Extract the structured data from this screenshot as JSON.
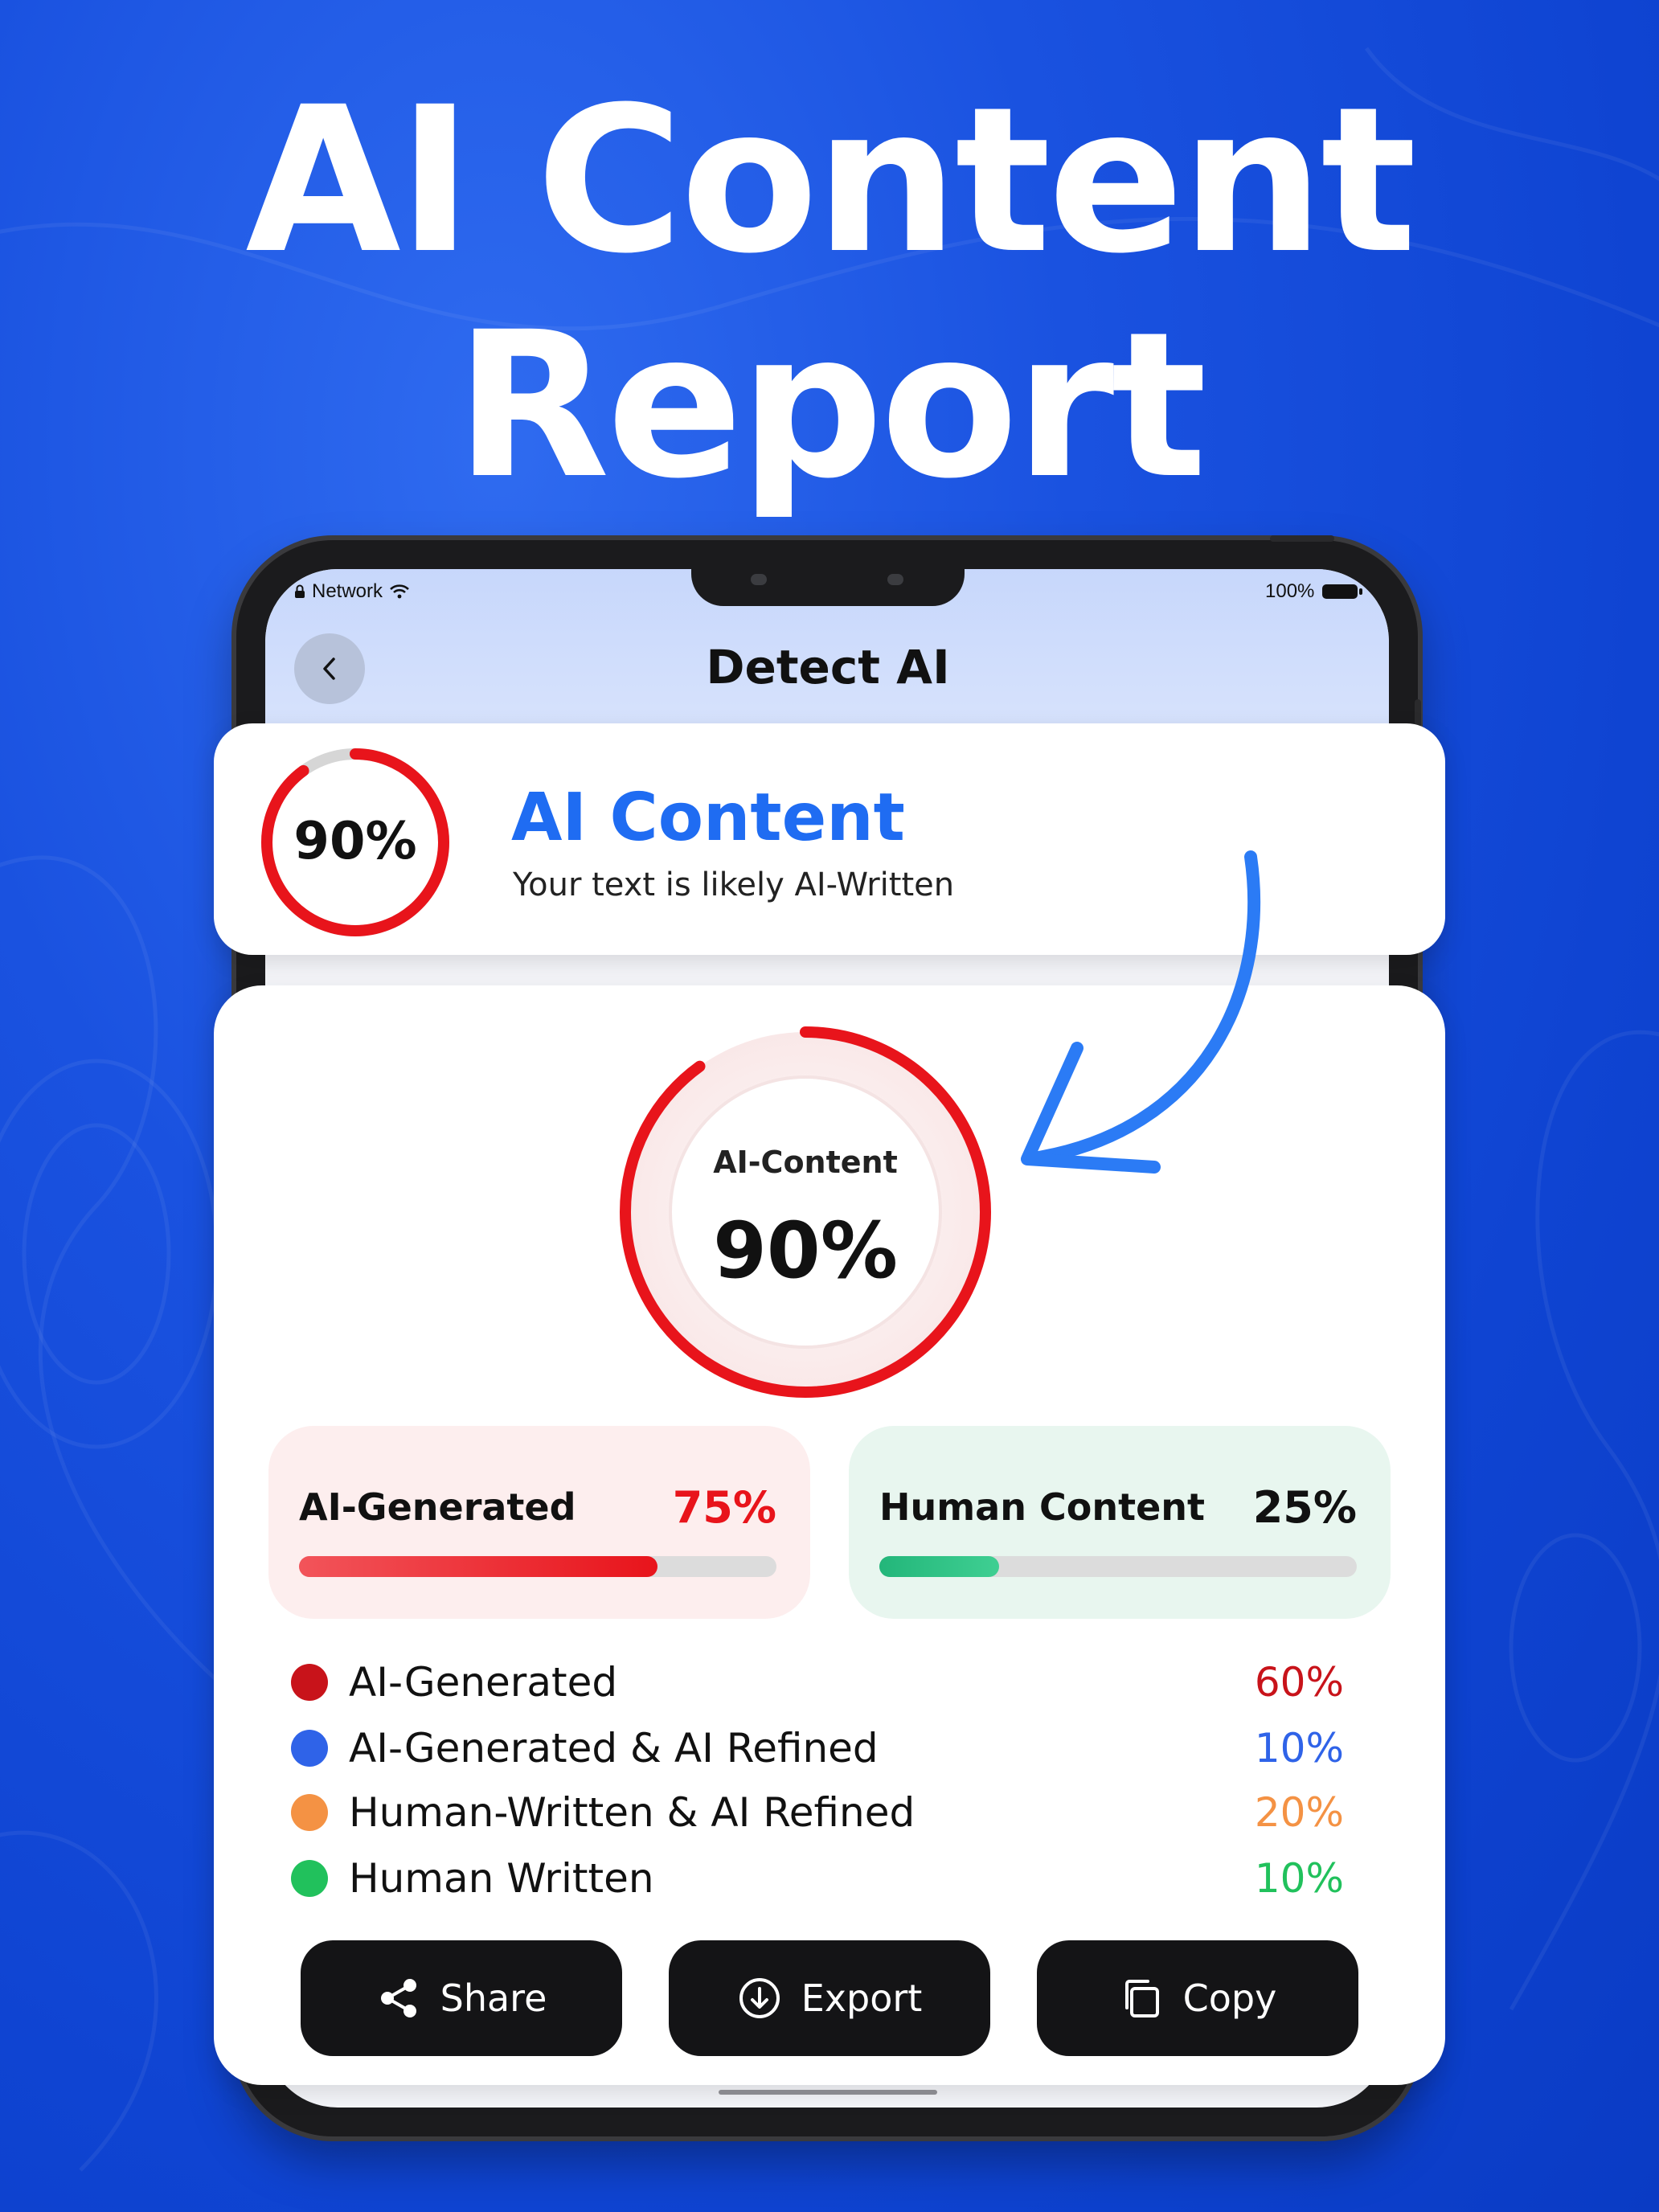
{
  "headline": {
    "line1": "AI Content",
    "line2": "Report"
  },
  "status_bar": {
    "network": "Network",
    "battery": "100%"
  },
  "nav": {
    "title": "Detect AI"
  },
  "summary_card": {
    "percent_label": "90%",
    "percent_value": 0.9,
    "title": "AI Content",
    "subtitle": "Your text is likely AI-Written"
  },
  "gauge": {
    "label": "AI-Content",
    "value_label": "90%",
    "value": 0.9
  },
  "stats": {
    "ai": {
      "label": "AI-Generated",
      "value_label": "75%",
      "value": 0.75
    },
    "human": {
      "label": "Human Content",
      "value_label": "25%",
      "value": 0.25
    }
  },
  "breakdown": [
    {
      "name": "AI-Generated",
      "value": "60%",
      "color": "#c8131a"
    },
    {
      "name": "AI-Generated & AI Refined",
      "value": "10%",
      "color": "#2f63e8"
    },
    {
      "name": "Human-Written & AI Refined",
      "value": "20%",
      "color": "#f49244"
    },
    {
      "name": "Human Written",
      "value": "10%",
      "color": "#21c15c"
    }
  ],
  "actions": {
    "share": "Share",
    "export": "Export",
    "copy": "Copy"
  },
  "colors": {
    "accent_blue": "#1f6cf2",
    "ai_red": "#e8141b",
    "human_green": "#2bbf82",
    "button_dark": "#141416"
  }
}
